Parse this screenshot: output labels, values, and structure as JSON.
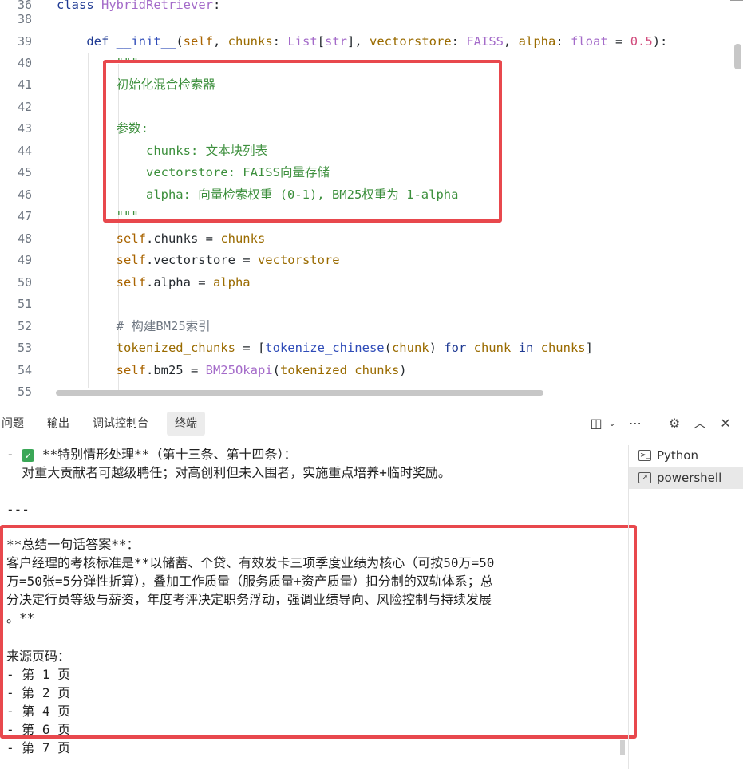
{
  "editor": {
    "lines": [
      {
        "n": "36",
        "parts": [
          [
            "kw",
            "class "
          ],
          [
            "cls",
            "HybridRetriever"
          ],
          [
            "plain",
            ":"
          ]
        ]
      },
      {
        "n": "38",
        "parts": []
      },
      {
        "n": "39",
        "parts": [
          [
            "plain",
            "    "
          ],
          [
            "kw",
            "def "
          ],
          [
            "fn",
            "__init__"
          ],
          [
            "plain",
            "("
          ],
          [
            "self",
            "self"
          ],
          [
            "plain",
            ", "
          ],
          [
            "prm",
            "chunks"
          ],
          [
            "plain",
            ": "
          ],
          [
            "typ",
            "List"
          ],
          [
            "plain",
            "["
          ],
          [
            "typ",
            "str"
          ],
          [
            "plain",
            "], "
          ],
          [
            "prm",
            "vectorstore"
          ],
          [
            "plain",
            ": "
          ],
          [
            "typ",
            "FAISS"
          ],
          [
            "plain",
            ", "
          ],
          [
            "prm",
            "alpha"
          ],
          [
            "plain",
            ": "
          ],
          [
            "typ",
            "float"
          ],
          [
            "plain",
            " = "
          ],
          [
            "num",
            "0.5"
          ],
          [
            "plain",
            "):"
          ]
        ]
      },
      {
        "n": "40",
        "parts": [
          [
            "plain",
            "        "
          ],
          [
            "str",
            "\"\"\""
          ]
        ]
      },
      {
        "n": "41",
        "parts": [
          [
            "plain",
            "        "
          ],
          [
            "str",
            "初始化混合检索器"
          ]
        ]
      },
      {
        "n": "42",
        "parts": []
      },
      {
        "n": "43",
        "parts": [
          [
            "plain",
            "        "
          ],
          [
            "str",
            "参数:"
          ]
        ]
      },
      {
        "n": "44",
        "parts": [
          [
            "plain",
            "            "
          ],
          [
            "str",
            "chunks: 文本块列表"
          ]
        ]
      },
      {
        "n": "45",
        "parts": [
          [
            "plain",
            "            "
          ],
          [
            "str",
            "vectorstore: FAISS向量存储"
          ]
        ]
      },
      {
        "n": "46",
        "parts": [
          [
            "plain",
            "            "
          ],
          [
            "str",
            "alpha: 向量检索权重 (0-1), BM25权重为 1-alpha"
          ]
        ]
      },
      {
        "n": "47",
        "parts": [
          [
            "plain",
            "        "
          ],
          [
            "str",
            "\"\"\""
          ]
        ]
      },
      {
        "n": "48",
        "parts": [
          [
            "plain",
            "        "
          ],
          [
            "self",
            "self"
          ],
          [
            "plain",
            ".chunks = "
          ],
          [
            "prm",
            "chunks"
          ]
        ]
      },
      {
        "n": "49",
        "parts": [
          [
            "plain",
            "        "
          ],
          [
            "self",
            "self"
          ],
          [
            "plain",
            ".vectorstore = "
          ],
          [
            "prm",
            "vectorstore"
          ]
        ]
      },
      {
        "n": "50",
        "parts": [
          [
            "plain",
            "        "
          ],
          [
            "self",
            "self"
          ],
          [
            "plain",
            ".alpha = "
          ],
          [
            "prm",
            "alpha"
          ]
        ]
      },
      {
        "n": "51",
        "parts": []
      },
      {
        "n": "52",
        "parts": [
          [
            "plain",
            "        "
          ],
          [
            "cmt",
            "# 构建BM25索引"
          ]
        ]
      },
      {
        "n": "53",
        "parts": [
          [
            "plain",
            "        "
          ],
          [
            "prm",
            "tokenized_chunks"
          ],
          [
            "plain",
            " = ["
          ],
          [
            "fn",
            "tokenize_chinese"
          ],
          [
            "plain",
            "("
          ],
          [
            "prm",
            "chunk"
          ],
          [
            "plain",
            ") "
          ],
          [
            "kw",
            "for "
          ],
          [
            "prm",
            "chunk"
          ],
          [
            "kw",
            " in "
          ],
          [
            "prm",
            "chunks"
          ],
          [
            "plain",
            "]"
          ]
        ]
      },
      {
        "n": "54",
        "parts": [
          [
            "plain",
            "        "
          ],
          [
            "self",
            "self"
          ],
          [
            "plain",
            ".bm25 = "
          ],
          [
            "cls",
            "BM25Okapi"
          ],
          [
            "plain",
            "("
          ],
          [
            "prm",
            "tokenized_chunks"
          ],
          [
            "plain",
            ")"
          ]
        ]
      },
      {
        "n": "55",
        "parts": []
      }
    ]
  },
  "panel": {
    "tabs": [
      {
        "label": "问题",
        "active": false
      },
      {
        "label": "输出",
        "active": false
      },
      {
        "label": "调试控制台",
        "active": false
      },
      {
        "label": "终端",
        "active": true
      }
    ],
    "terminal_lines": [
      {
        "text": "**特别情形处理**（第十三条、第十四条）：",
        "prefix": "- ",
        "check": true
      },
      {
        "text": "  对重大贡献者可越级聘任；对高创利但未入围者，实施重点培养+临时奖励。"
      },
      {
        "text": ""
      },
      {
        "text": "---"
      },
      {
        "text": ""
      },
      {
        "text": "**总结一句话答案**："
      },
      {
        "text": "客户经理的考核标准是**以储蓄、个贷、有效发卡三项季度业绩为核心（可按50万=50"
      },
      {
        "text": "万=50张=5分弹性折算），叠加工作质量（服务质量+资产质量）扣分制的双轨体系；总"
      },
      {
        "text": "分决定行员等级与薪资，年度考评决定职务浮动，强调业绩导向、风险控制与持续发展"
      },
      {
        "text": "。**"
      },
      {
        "text": ""
      },
      {
        "text": "来源页码："
      },
      {
        "text": "- 第 1 页"
      },
      {
        "text": "- 第 2 页"
      },
      {
        "text": "- 第 4 页"
      },
      {
        "text": "- 第 6 页"
      },
      {
        "text": "- 第 7 页"
      }
    ],
    "side_items": [
      {
        "label": "Python",
        "selected": false
      },
      {
        "label": "powershell",
        "selected": true
      }
    ]
  },
  "colors": {
    "highlight": "#e8484d",
    "string": "#3c8f3c",
    "keyword": "#1f3a93"
  }
}
